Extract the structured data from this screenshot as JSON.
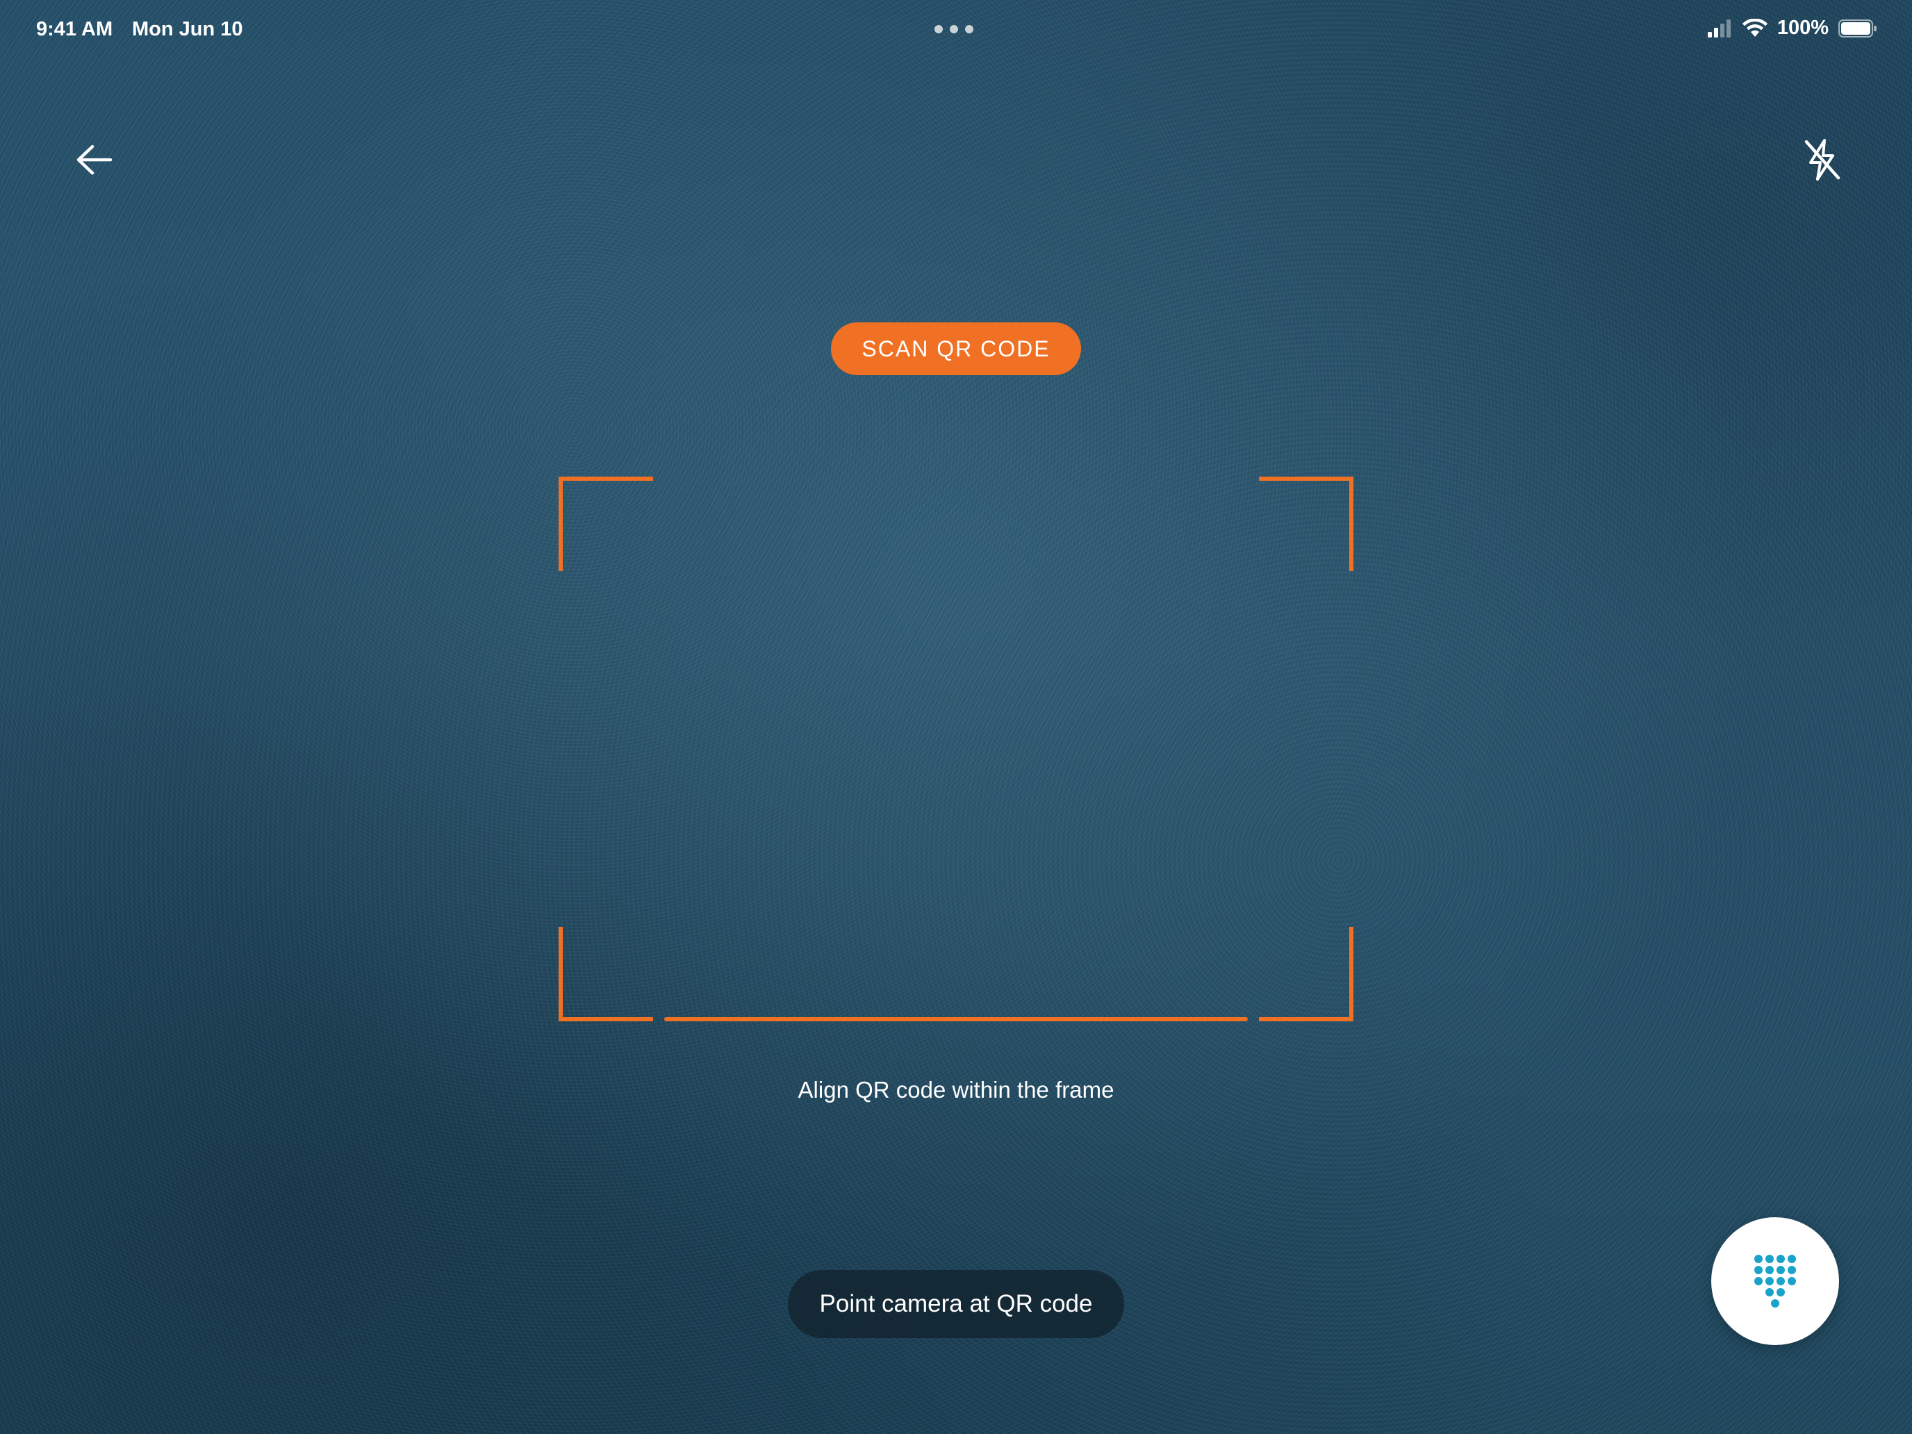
{
  "status_bar": {
    "time": "9:41 AM",
    "date": "Mon Jun 10",
    "battery": "100%"
  },
  "header": {
    "back_icon": "arrow-left-icon",
    "flash_icon": "flash-off-icon"
  },
  "scanner": {
    "title": "SCAN QR CODE",
    "hint": "Align QR code within the frame",
    "toast": "Point camera at QR code"
  },
  "fab": {
    "icon": "dialpad-icon"
  },
  "colors": {
    "accent": "#f07024",
    "keypad_dots": "#1aa3c9",
    "background": "#25506a"
  }
}
